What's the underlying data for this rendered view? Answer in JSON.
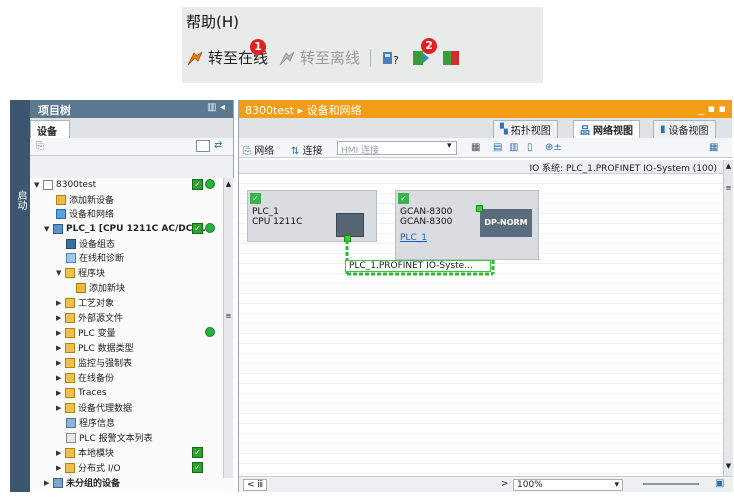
{
  "top": {
    "menu_label": "帮助(H)",
    "go_online": "转至在线",
    "go_offline": "转至离线",
    "badge1": "1",
    "badge2": "2"
  },
  "vertical_tab": "启动",
  "tree": {
    "header": "项目树",
    "tab": "设备",
    "items": [
      {
        "label": "8300test"
      },
      {
        "label": "添加新设备"
      },
      {
        "label": "设备和网络"
      },
      {
        "label": "PLC_1 [CPU 1211C AC/DC/..."
      },
      {
        "label": "设备组态"
      },
      {
        "label": "在线和诊断"
      },
      {
        "label": "程序块"
      },
      {
        "label": "添加新块"
      },
      {
        "label": "工艺对象"
      },
      {
        "label": "外部源文件"
      },
      {
        "label": "PLC 变量"
      },
      {
        "label": "PLC 数据类型"
      },
      {
        "label": "监控与强制表"
      },
      {
        "label": "在线备份"
      },
      {
        "label": "Traces"
      },
      {
        "label": "设备代理数据"
      },
      {
        "label": "程序信息"
      },
      {
        "label": "PLC 报警文本列表"
      },
      {
        "label": "本地模块"
      },
      {
        "label": "分布式 I/O"
      },
      {
        "label": "未分组的设备"
      }
    ]
  },
  "main": {
    "breadcrumb": "8300test ▸ 设备和网络",
    "tabs": {
      "topology": "拓扑视图",
      "network": "网络视图",
      "device": "设备视图"
    },
    "toolbar": {
      "network": "网络",
      "connection": "连接",
      "hmi_placeholder": "HMI 连接"
    },
    "io_system": "IO 系统: PLC_1.PROFINET IO-System (100)",
    "devices": {
      "plc": {
        "name": "PLC_1",
        "type": "CPU 1211C"
      },
      "gcan": {
        "name": "GCAN-8300",
        "type": "GCAN-8300",
        "link": "PLC_1",
        "module": "DP-NORM"
      }
    },
    "bus_label": "PLC_1.PROFINET IO-Syste...",
    "zoom": "100%"
  },
  "colors": {
    "title_orange": "#f29d17",
    "tree_header": "#5b7891",
    "ok_green": "#2ea12e"
  }
}
